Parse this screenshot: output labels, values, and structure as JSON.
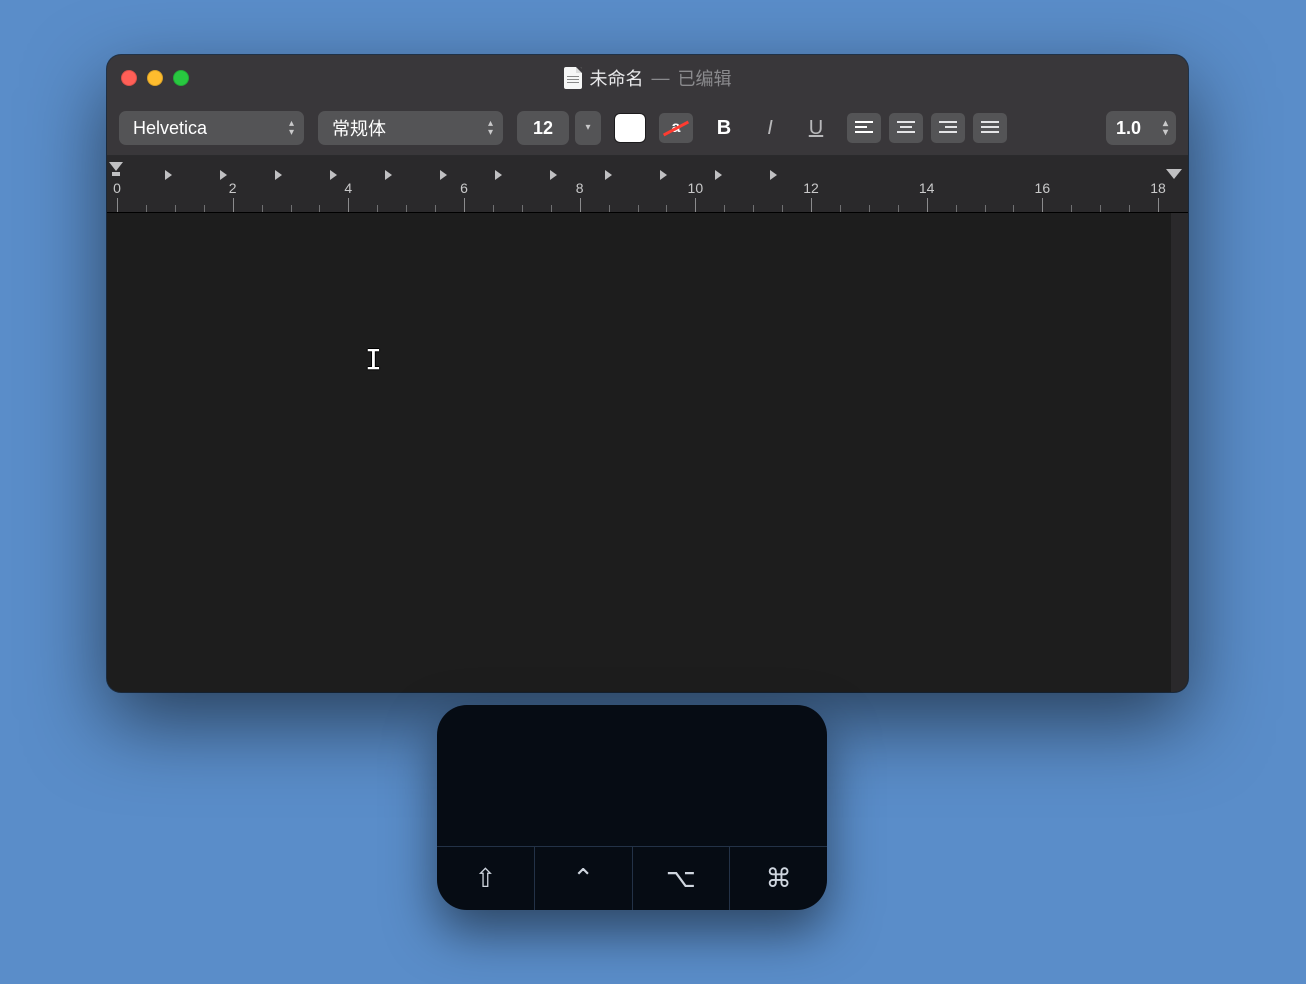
{
  "window": {
    "title": "未命名",
    "status": "已编辑"
  },
  "toolbar": {
    "font_family": "Helvetica",
    "font_style": "常规体",
    "font_size": "12",
    "bold": "B",
    "italic": "I",
    "underline": "U",
    "line_spacing": "1.0",
    "char_indicator": "a"
  },
  "ruler": {
    "major_labels": [
      "0",
      "2",
      "4",
      "6",
      "8",
      "10",
      "12",
      "14",
      "16",
      "18"
    ],
    "tab_count": 12
  },
  "modifier_keys": {
    "shift": "⇧",
    "control": "⌃",
    "option": "⌥",
    "command": "⌘"
  }
}
